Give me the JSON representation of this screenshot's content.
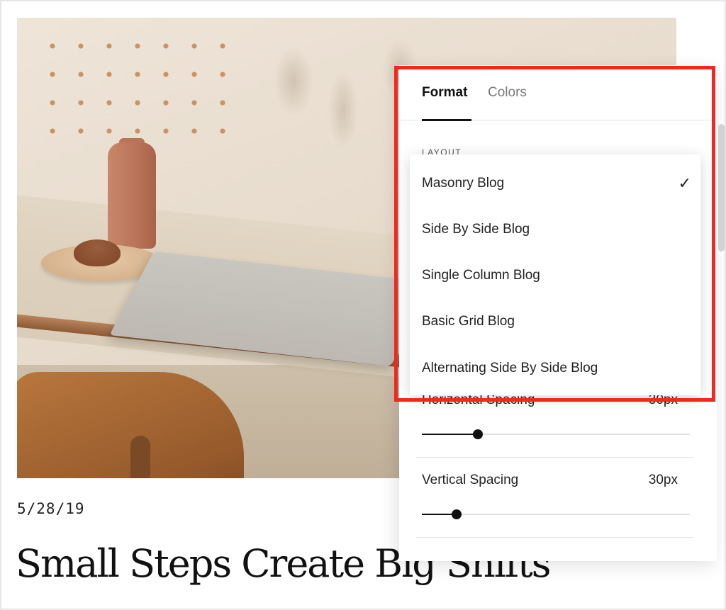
{
  "post": {
    "date": "5/28/19",
    "title": "Small Steps Create Big Shifts"
  },
  "panel": {
    "tabs": [
      {
        "label": "Format",
        "active": true
      },
      {
        "label": "Colors",
        "active": false
      }
    ],
    "layout_label": "LAYOUT",
    "horizontal_spacing": {
      "label": "Horizontal Spacing",
      "value": "30px",
      "level": 0.21
    },
    "vertical_spacing": {
      "label": "Vertical Spacing",
      "value": "30px",
      "level": 0.13
    }
  },
  "dropdown": {
    "selected": "Masonry Blog",
    "check_icon": "checkmark-icon",
    "options": [
      {
        "label": "Masonry Blog"
      },
      {
        "label": "Side By Side Blog"
      },
      {
        "label": "Single Column Blog"
      },
      {
        "label": "Basic Grid Blog"
      },
      {
        "label": "Alternating Side By Side Blog"
      }
    ]
  },
  "colors": {
    "highlight": "#f2281e",
    "text": "#222222",
    "tab_inactive": "#7a7a7a"
  }
}
